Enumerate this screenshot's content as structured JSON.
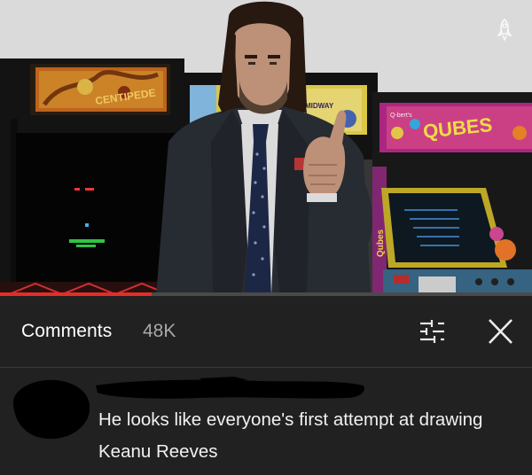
{
  "video": {
    "progress_fraction": 0.285,
    "arcade_marquees": {
      "left": "CENTIPEDE",
      "middle_brand": "MIDWAY",
      "right_brand": "Q-bert's",
      "right_title": "QUBES"
    },
    "side_panel_text": "Qubes",
    "watermark_icon": "rocket-icon"
  },
  "comments": {
    "label": "Comments",
    "count": "48K",
    "filter_icon": "sliders-icon",
    "close_icon": "close-icon"
  },
  "comment": {
    "text": "He looks like everyone's first attempt at drawing Keanu Reeves"
  },
  "colors": {
    "background": "#212121",
    "progress": "#e52d27",
    "count_text": "#a8a8a8"
  }
}
